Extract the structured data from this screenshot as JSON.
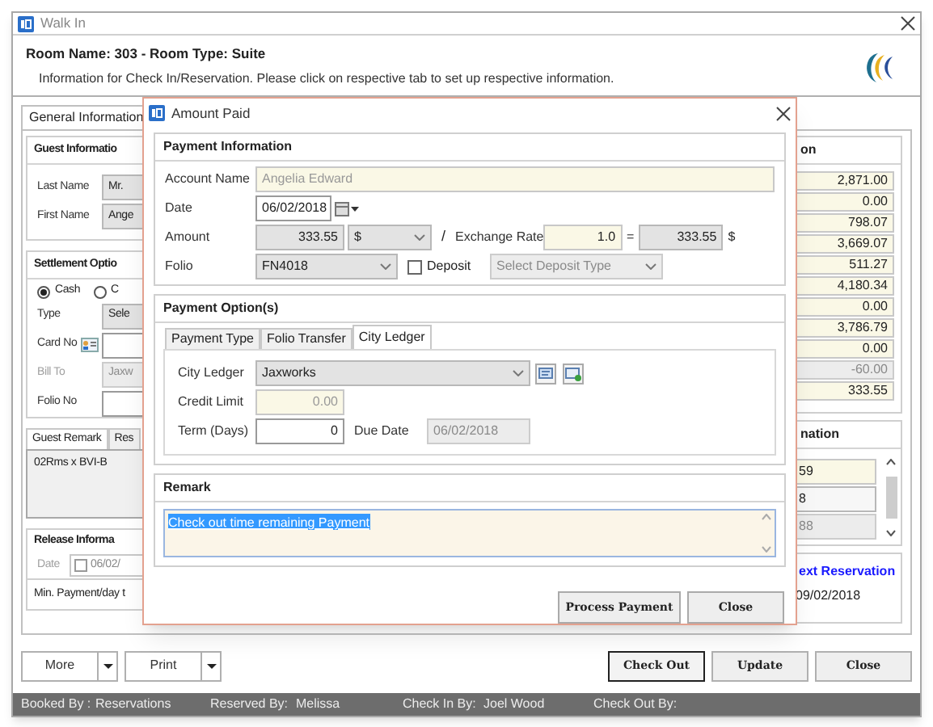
{
  "window": {
    "title": "Walk In"
  },
  "header": {
    "title": "Room Name: 303 - Room Type: Suite",
    "subtitle": "Information for Check In/Reservation. Please click on respective tab to set up respective information."
  },
  "main_tabs": [
    {
      "label": "General Information",
      "selected": true
    }
  ],
  "guest_info": {
    "title": "Guest Informatio",
    "fields": [
      {
        "label": "Last Name",
        "value": "Mr."
      },
      {
        "label": "First Name",
        "value": "Ange"
      }
    ]
  },
  "settlement": {
    "title": "Settlement Optio",
    "options": [
      {
        "label": "Cash",
        "selected": true
      },
      {
        "label": "C",
        "selected": false
      }
    ],
    "fields": [
      {
        "kind": "select",
        "label": "Type",
        "value": "Sele",
        "disabled": false
      },
      {
        "kind": "card",
        "label": "Card No",
        "disabled": false
      },
      {
        "kind": "select",
        "label": "Bill To",
        "value": "Jaxw",
        "disabled": true
      },
      {
        "kind": "text",
        "label": "Folio No",
        "disabled": false
      }
    ]
  },
  "remark_tabs": [
    {
      "label": "Guest Remark",
      "selected": true
    },
    {
      "label": "Res",
      "selected": false
    }
  ],
  "guest_remark": "02Rms x BVI-B",
  "release": {
    "title": "Release Informa",
    "date_label": "Date",
    "date_checked": false,
    "date": "06/02/",
    "min_payment": "Min. Payment/day t"
  },
  "summary": {
    "title": "on",
    "values": [
      {
        "value": "2,871.00",
        "disabled": false
      },
      {
        "value": "0.00",
        "disabled": false
      },
      {
        "value": "798.07",
        "disabled": false
      },
      {
        "value": "3,669.07",
        "disabled": false
      },
      {
        "value": "511.27",
        "disabled": false
      },
      {
        "value": "4,180.34",
        "disabled": false
      },
      {
        "value": "0.00",
        "disabled": false
      },
      {
        "value": "3,786.79",
        "disabled": false
      },
      {
        "value": "0.00",
        "disabled": false
      },
      {
        "value": "-60.00",
        "disabled": true
      },
      {
        "value": "333.55",
        "disabled": false
      }
    ]
  },
  "nation": {
    "title": "nation",
    "values": [
      {
        "value": "59",
        "kind": "readonly"
      },
      {
        "value": "8",
        "kind": "plain"
      },
      {
        "value": "88",
        "kind": "disabled"
      }
    ]
  },
  "next_reservation": {
    "title": "ext Reservation",
    "date": "09/02/2018"
  },
  "buttons": [
    {
      "label": "More",
      "kind": "split"
    },
    {
      "label": "Print",
      "kind": "split"
    },
    {
      "label": "Check Out",
      "kind": "default"
    },
    {
      "label": "Update",
      "kind": "plain"
    },
    {
      "label": "Close",
      "kind": "plain"
    }
  ],
  "status_bar": [
    {
      "label": "Booked By :",
      "value": "Reservations"
    },
    {
      "label": "Reserved By:",
      "value": "Melissa"
    },
    {
      "label": "Check In By:",
      "value": "Joel Wood"
    },
    {
      "label": "Check Out By:"
    }
  ],
  "dialog": {
    "title": "Amount Paid",
    "payment_info": {
      "title": "Payment Information",
      "account_label": "Account Name",
      "account": "Angelia Edward",
      "date_label": "Date",
      "date": "06/02/2018",
      "amount_label": "Amount",
      "amount": "333.55",
      "currency": "$",
      "slash": "/",
      "rate_label": "Exchange Rate",
      "rate": "1.0",
      "equals": "=",
      "converted": "333.55",
      "converted_currency": "$",
      "folio_label": "Folio",
      "folio": "FN4018",
      "deposit_label": "Deposit",
      "deposit_checked": false,
      "deposit_type": {
        "placeholder": "Select Deposit Type",
        "disabled": true
      }
    },
    "payment_options": {
      "title": "Payment Option(s)",
      "tabs": [
        {
          "label": "Payment Type",
          "selected": false
        },
        {
          "label": "Folio Transfer",
          "selected": false
        },
        {
          "label": "City Ledger",
          "selected": true
        }
      ],
      "ledger_label": "City Ledger",
      "ledger": "Jaxworks",
      "credit_label": "Credit Limit",
      "credit": "0.00",
      "term_label": "Term (Days)",
      "term": "0",
      "due_label": "Due Date",
      "due": "06/02/2018"
    },
    "remark": {
      "title": "Remark",
      "text": "Check out time remaining Payment",
      "selected": true
    },
    "buttons": [
      {
        "label": "Process Payment"
      },
      {
        "label": "Close"
      }
    ]
  }
}
